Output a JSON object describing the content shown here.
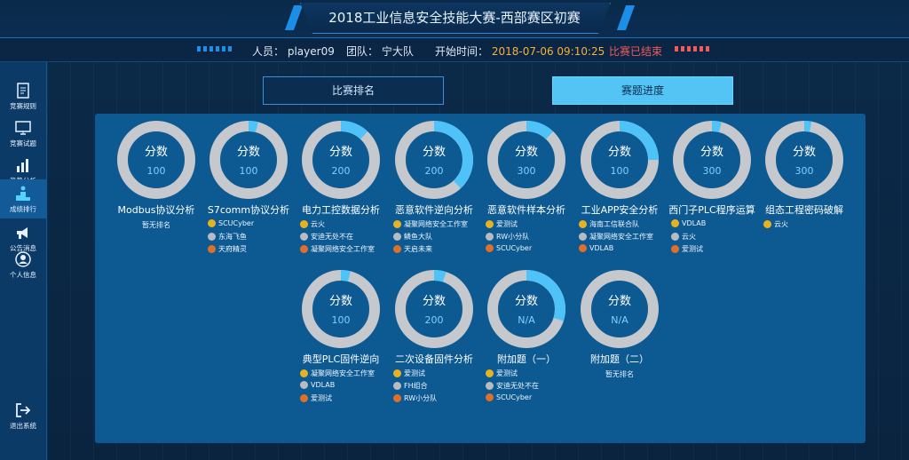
{
  "header": {
    "title": "2018工业信息安全技能大赛-西部赛区初赛",
    "person_label": "人员：",
    "person_value": "player09",
    "team_label": "团队：",
    "team_value": "宁大队",
    "start_label": "开始时间：",
    "start_value": "2018-07-06 09:10:25",
    "status": "比赛已结束"
  },
  "colors": {
    "accent": "#1d8ee8",
    "start_time": "#f5b13d",
    "status": "#f25a5a",
    "ring_bg": "#c5c8cc",
    "ring_fill": "#4fc3f7"
  },
  "sidebar": {
    "items": [
      {
        "label": "竞赛规则",
        "icon": "document-icon"
      },
      {
        "label": "竞赛试题",
        "icon": "monitor-icon"
      },
      {
        "label": "趋势分析",
        "icon": "bar-chart-icon"
      },
      {
        "label": "成绩排行",
        "icon": "podium-icon"
      },
      {
        "label": "公告消息",
        "icon": "megaphone-icon"
      },
      {
        "label": "个人信息",
        "icon": "user-icon"
      },
      {
        "label": "退出系统",
        "icon": "logout-icon"
      }
    ]
  },
  "tabs": {
    "ranking": "比赛排名",
    "progress": "赛题进度"
  },
  "ring_label": "分数",
  "no_ranking": "暂无排名",
  "challenges": [
    {
      "name": "Modbus协议分析",
      "score": "100",
      "progress": 0.0,
      "ranks": []
    },
    {
      "name": "S7comm协议分析",
      "score": "100",
      "progress": 0.04,
      "ranks": [
        "SCUCyber",
        "东海飞鱼",
        "天府精灵"
      ]
    },
    {
      "name": "电力工控数据分析",
      "score": "200",
      "progress": 0.12,
      "ranks": [
        "云火",
        "安迪无处不在",
        "凝聚网络安全工作室"
      ]
    },
    {
      "name": "恶意软件逆向分析",
      "score": "200",
      "progress": 0.38,
      "ranks": [
        "凝聚网络安全工作室",
        "鳞鱼大队",
        "天启未来"
      ]
    },
    {
      "name": "恶意软件样本分析",
      "score": "300",
      "progress": 0.12,
      "ranks": [
        "爱测试",
        "RW小分队",
        "SCUCyber"
      ]
    },
    {
      "name": "工业APP安全分析",
      "score": "100",
      "progress": 0.25,
      "ranks": [
        "海南工信联合队",
        "凝聚网络安全工作室",
        "VDLAB"
      ]
    },
    {
      "name": "西门子PLC程序运算",
      "score": "300",
      "progress": 0.04,
      "ranks": [
        "VDLAB",
        "云火",
        "爱测试"
      ]
    },
    {
      "name": "组态工程密码破解",
      "score": "300",
      "progress": 0.03,
      "ranks": [
        "云火"
      ]
    },
    {
      "name": "典型PLC固件逆向",
      "score": "100",
      "progress": 0.04,
      "ranks": [
        "凝聚网络安全工作室",
        "VDLAB",
        "爱测试"
      ]
    },
    {
      "name": "二次设备固件分析",
      "score": "200",
      "progress": 0.05,
      "ranks": [
        "爱测试",
        "FH组合",
        "RW小分队"
      ]
    },
    {
      "name": "附加题（一）",
      "score": "N/A",
      "progress": 0.3,
      "ranks": [
        "爱测试",
        "安迪无处不在",
        "SCUCyber"
      ]
    },
    {
      "name": "附加题（二）",
      "score": "N/A",
      "progress": 0.0,
      "ranks": []
    }
  ]
}
